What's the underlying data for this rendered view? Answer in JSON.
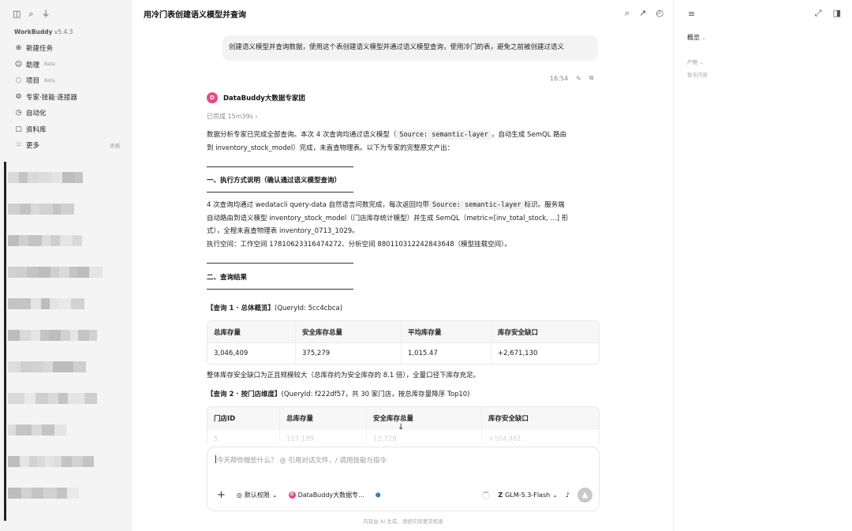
{
  "app": {
    "name": "WorkBuddy",
    "version": "v5.4.3"
  },
  "sidebar": {
    "items": [
      {
        "icon": "⊕",
        "label": "新建任务",
        "badge": "",
        "right": ""
      },
      {
        "icon": "☺",
        "label": "助理",
        "badge": "Beta",
        "right": ""
      },
      {
        "icon": "◌",
        "label": "项目",
        "badge": "Beta",
        "right": ""
      },
      {
        "icon": "⚙",
        "label": "专家·技能·连接器",
        "badge": "",
        "right": ""
      },
      {
        "icon": "◷",
        "label": "自动化",
        "badge": "",
        "right": ""
      },
      {
        "icon": "▢",
        "label": "资料库",
        "badge": "",
        "right": ""
      },
      {
        "icon": "⁙",
        "label": "更多",
        "badge": "",
        "right": "灵感"
      }
    ]
  },
  "header": {
    "title": "用冷门表创建语义模型并查询"
  },
  "right_panel": {
    "overview": "概览",
    "outputs": "产物",
    "empty": "暂无内容"
  },
  "chat": {
    "user_message": "创建语义模型并查询数据，使用这个表创建语义模型并通过语义模型查询，使用冷门的表，避免之前被创建过语义",
    "time": "16:54",
    "agent_name": "DataBuddy大数据专家团",
    "agent_initial": "D",
    "status": "已完成 15m39s",
    "intro_a": "数据分析专家已完成全部查询。本次 4 次查询均通过语义模型（",
    "intro_code": "Source: semantic-layer",
    "intro_b": "，自动生成 SemQL 路由",
    "intro_line2": "到 inventory_stock_model）完成，未直查物理表。以下为专家的完整原文产出：",
    "section1": "一、执行方式说明（确认通过语义模型查询）",
    "exec_a": "4 次查询均通过 wedatacli query-data 自然语言问数完成，每次返回均带",
    "exec_code": "Source: semantic-layer",
    "exec_b": "标识。服务端",
    "exec_line2": "自动路由到语义模型 inventory_stock_model（门店库存统计模型）并生成 SemQL（metric=[inv_total_stock, ...] 形",
    "exec_line3": "式），全程未直查物理表 inventory_0713_1029。",
    "exec_line4": "执行空间：工作空间 17810623316474272、分析空间 880110312242843648（模型挂载空间）。",
    "section2": "二、查询结果",
    "q1_bold": "【查询 1 · 总体概览】",
    "q1_rest": "(QueryId: 5cc4cbca)",
    "table1": {
      "headers": [
        "总库存量",
        "安全库存总量",
        "平均库存量",
        "库存安全缺口"
      ],
      "rows": [
        [
          "3,046,409",
          "375,279",
          "1,015.47",
          "+2,671,130"
        ]
      ]
    },
    "q1_summary": "整体库存安全缺口为正且规模较大（总库存约为安全库存的 8.1 倍），全量口径下库存充足。",
    "q2_bold": "【查询 2 · 按门店维度】",
    "q2_rest": "(QueryId: f222df57，共 30 家门店，按总库存量降序 Top10)",
    "table2": {
      "headers": [
        "门店ID",
        "总库存量",
        "安全库存总量",
        "库存安全缺口"
      ],
      "rows": [
        [
          "5",
          "117,189",
          "12,728",
          "+104,461"
        ]
      ]
    }
  },
  "composer": {
    "placeholder": "今天帮你做些什么？ @ 引用对话文件，/ 调用技能与指令",
    "permission": "默认权限",
    "agent_chip": "DataBuddy大数据专...",
    "model": "GLM-5.3-Flash",
    "footnote": "内容由 AI 生成，请按实际要求核查"
  },
  "colors": {
    "accent": "#e8488a",
    "sidebar_bg": "#f4f4f4"
  }
}
